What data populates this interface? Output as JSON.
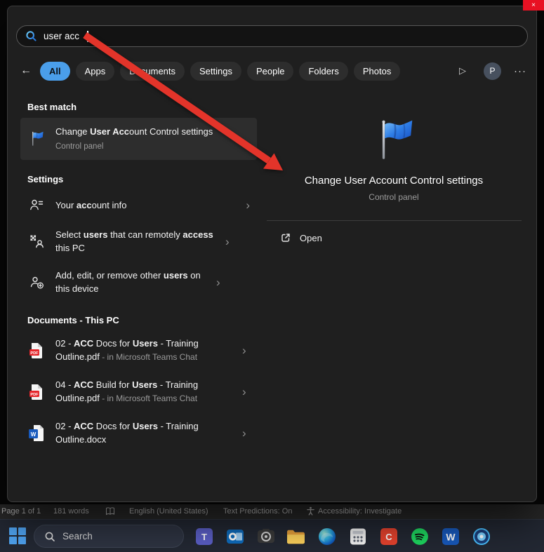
{
  "glyphs": {
    "chevron": "›",
    "back": "←",
    "play": "▷",
    "more": "···",
    "close": "×"
  },
  "search_panel": {
    "query": "user acc",
    "tabs": [
      "All",
      "Apps",
      "Documents",
      "Settings",
      "People",
      "Folders",
      "Photos"
    ],
    "active_tab": "All",
    "profile_initial": "P"
  },
  "results": {
    "best_match_header": "Best match",
    "best_match": {
      "title_segments": [
        {
          "t": "Change "
        },
        {
          "t": "User Acc",
          "b": 1
        },
        {
          "t": "ount Control settings"
        }
      ],
      "subtitle": "Control panel"
    },
    "settings_header": "Settings",
    "settings_items": [
      {
        "segments": [
          {
            "t": "Your "
          },
          {
            "t": "acc",
            "b": 1
          },
          {
            "t": "ount info"
          }
        ]
      },
      {
        "segments": [
          {
            "t": "Select "
          },
          {
            "t": "users",
            "b": 1
          },
          {
            "t": " that can remotely "
          },
          {
            "t": "access",
            "b": 1
          },
          {
            "t": " this PC"
          }
        ]
      },
      {
        "segments": [
          {
            "t": "Add, edit, or remove other "
          },
          {
            "t": "users",
            "b": 1
          },
          {
            "t": " on this device"
          }
        ]
      }
    ],
    "documents_header": "Documents - This PC",
    "document_items": [
      {
        "segments": [
          {
            "t": "02 - "
          },
          {
            "t": "ACC",
            "b": 1
          },
          {
            "t": " Docs for "
          },
          {
            "t": "Users",
            "b": 1
          },
          {
            "t": " - Training Outline.pdf"
          },
          {
            "t": " - in Microsoft Teams Chat",
            "d": 1
          }
        ]
      },
      {
        "segments": [
          {
            "t": "04 - "
          },
          {
            "t": "ACC",
            "b": 1
          },
          {
            "t": " Build for "
          },
          {
            "t": "Users",
            "b": 1
          },
          {
            "t": " - Training Outline.pdf"
          },
          {
            "t": " - in Microsoft Teams Chat",
            "d": 1
          }
        ]
      },
      {
        "segments": [
          {
            "t": "02 - "
          },
          {
            "t": "ACC",
            "b": 1
          },
          {
            "t": " Docs for "
          },
          {
            "t": "Users",
            "b": 1
          },
          {
            "t": " - Training Outline.docx"
          }
        ]
      }
    ]
  },
  "preview": {
    "title": "Change User Account Control settings",
    "subtitle": "Control panel",
    "open_label": "Open"
  },
  "status_bar": {
    "page": "Page 1 of 1",
    "words": "181 words",
    "language": "English (United States)",
    "predictions": "Text Predictions: On",
    "accessibility": "Accessibility: Investigate"
  },
  "taskbar": {
    "search_placeholder": "Search",
    "app_icons": [
      "teams-icon",
      "outlook-icon",
      "camera-icon",
      "file-explorer-icon",
      "edge-icon",
      "calculator-icon",
      "c-app-icon",
      "spotify-icon",
      "word-icon",
      "photos-icon"
    ],
    "teams_glyph": "T",
    "c_glyph": "C",
    "word_glyph": "W"
  },
  "annotation": {
    "arrow_color": "#e3342a"
  }
}
